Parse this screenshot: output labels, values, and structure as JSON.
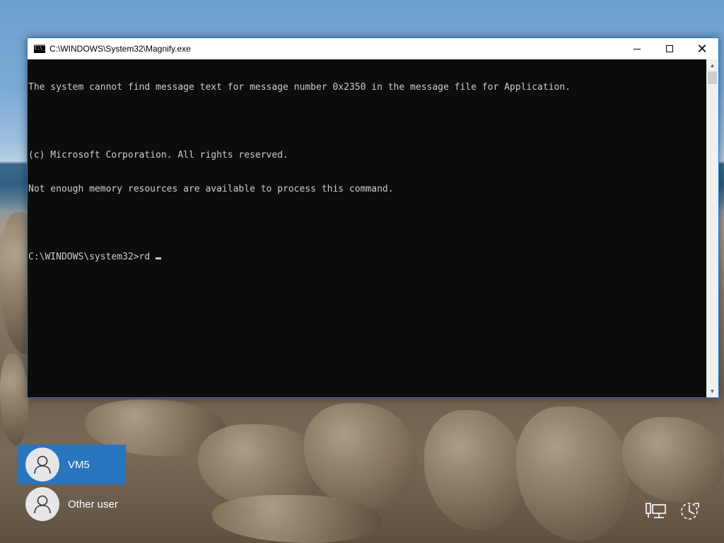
{
  "window": {
    "title": "C:\\WINDOWS\\System32\\Magnify.exe",
    "icon": "console-icon",
    "buttons": [
      "minimize",
      "maximize",
      "close"
    ]
  },
  "console": {
    "lines": [
      "The system cannot find message text for message number 0x2350 in the message file for Application.",
      "",
      "(c) Microsoft Corporation. All rights reserved.",
      "Not enough memory resources are available to process this command.",
      "",
      "C:\\WINDOWS\\system32>rd"
    ],
    "text_color": "#cccccc",
    "background": "#0c0c0c"
  },
  "users": [
    {
      "name": "VM5",
      "selected": true
    },
    {
      "name": "Other user",
      "selected": false
    }
  ],
  "tray": {
    "network_icon": "network-icon",
    "accessibility_icon": "ease-of-access-icon"
  },
  "accent_color": "#2a75c0"
}
